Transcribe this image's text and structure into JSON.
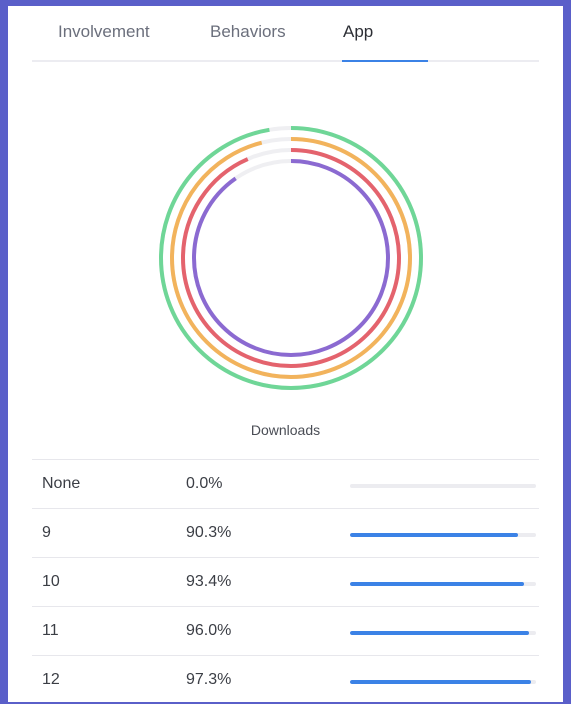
{
  "tabs": [
    {
      "label": "Involvement",
      "active": false
    },
    {
      "label": "Behaviors",
      "active": false
    },
    {
      "label": "App",
      "active": true
    }
  ],
  "chart_data": {
    "type": "radial-bar",
    "title": "Downloads",
    "series": [
      {
        "value": 0.973,
        "color": "#6fd697"
      },
      {
        "value": 0.96,
        "color": "#f2b35c"
      },
      {
        "value": 0.934,
        "color": "#e4636d"
      },
      {
        "value": 0.903,
        "color": "#8b6ad1"
      }
    ],
    "track_color": "#efeff2"
  },
  "table": {
    "bar_color": "#3b82e6",
    "rows": [
      {
        "label": "None",
        "percent": "0.0%",
        "value": 0.0
      },
      {
        "label": "9",
        "percent": "90.3%",
        "value": 0.903
      },
      {
        "label": "10",
        "percent": "93.4%",
        "value": 0.934
      },
      {
        "label": "11",
        "percent": "96.0%",
        "value": 0.96
      },
      {
        "label": "12",
        "percent": "97.3%",
        "value": 0.973
      }
    ]
  }
}
